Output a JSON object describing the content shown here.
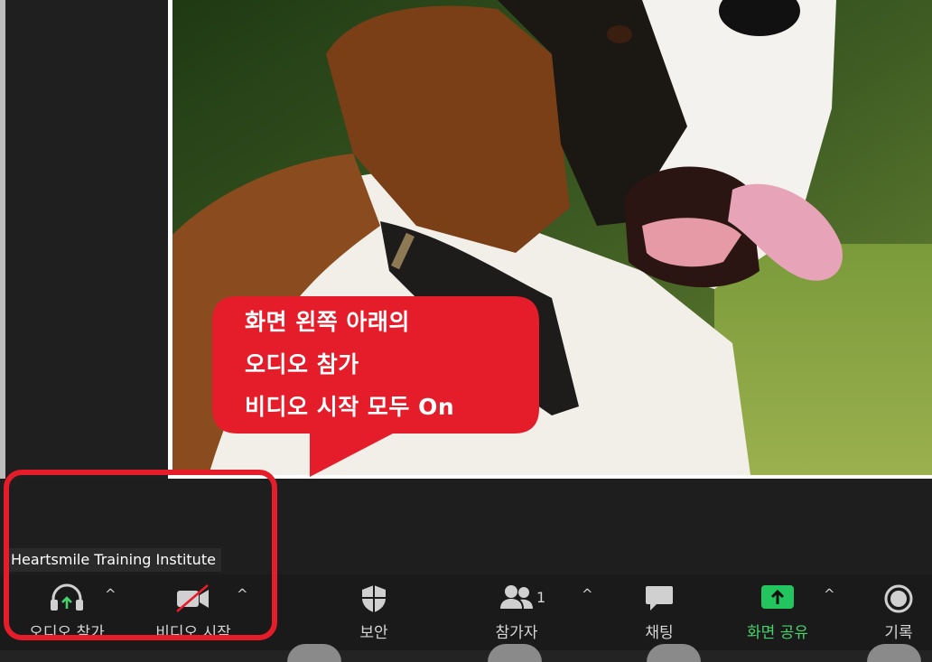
{
  "callout": {
    "line1": "화면 왼쪽 아래의",
    "line2": "오디오 참가",
    "line3": "비디오 시작 모두 On"
  },
  "participant_name": "Heartsmile Training Institute",
  "toolbar": {
    "audio_label": "오디오 참가",
    "video_label": "비디오 시작",
    "security_label": "보안",
    "participants_label": "참가자",
    "participants_count": "1",
    "chat_label": "채팅",
    "share_label": "화면 공유",
    "record_label": "기록",
    "caret": "^"
  },
  "icons": {
    "audio": "headphones-join-icon",
    "video": "video-off-icon",
    "security": "shield-icon",
    "participants": "people-icon",
    "chat": "chat-bubble-icon",
    "share": "share-screen-up-arrow-icon",
    "record": "record-icon"
  },
  "colors": {
    "accent_green": "#45d36b",
    "callout_red": "#e51d2a",
    "share_button_green": "#22c55e",
    "toolbar_bg": "#1a1a1a"
  }
}
